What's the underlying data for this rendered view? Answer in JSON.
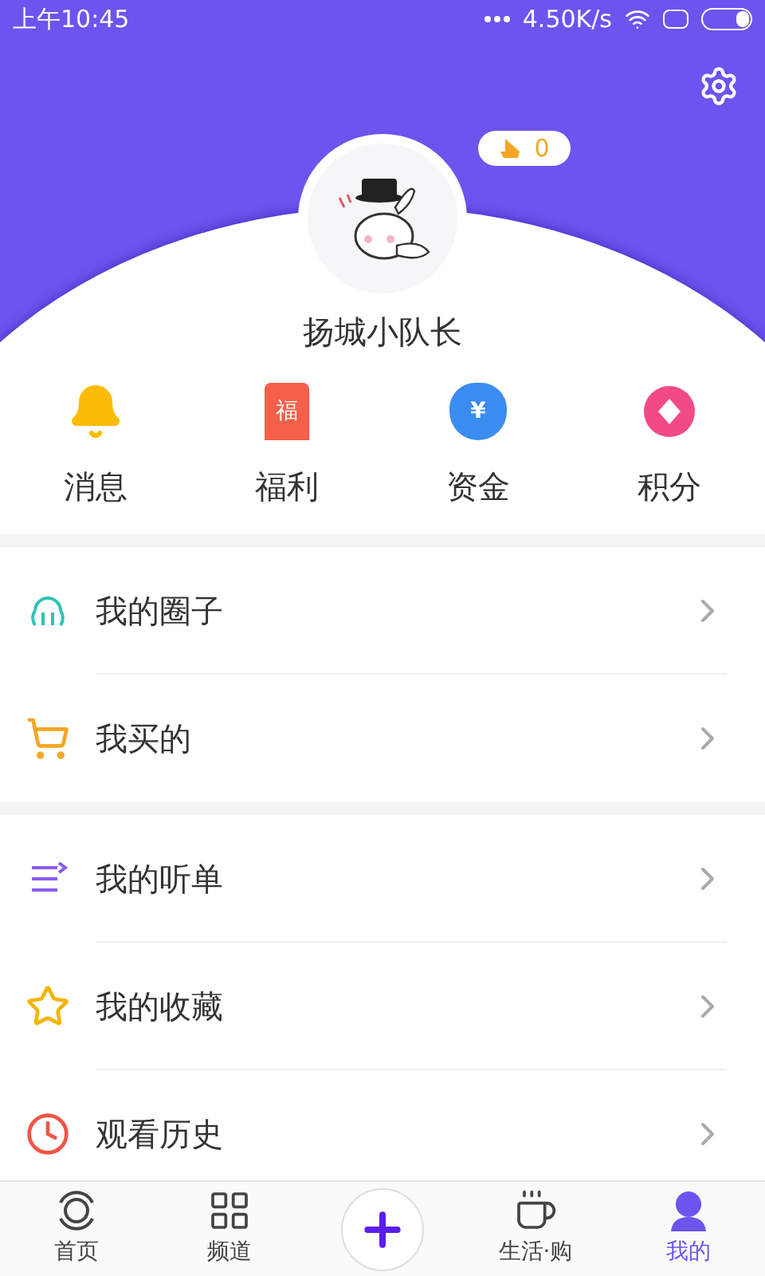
{
  "status_bar": {
    "time": "上午10:45",
    "speed": "4.50K/s"
  },
  "profile": {
    "name": "扬城小队长",
    "coins": "0"
  },
  "quick_actions": [
    {
      "label": "消息"
    },
    {
      "label": "福利",
      "icon_text": "福"
    },
    {
      "label": "资金",
      "icon_text": "¥"
    },
    {
      "label": "积分"
    }
  ],
  "menu_sections": [
    [
      {
        "label": "我的圈子"
      },
      {
        "label": "我买的"
      }
    ],
    [
      {
        "label": "我的听单"
      },
      {
        "label": "我的收藏"
      },
      {
        "label": "观看历史"
      }
    ]
  ],
  "bottom_nav": [
    {
      "kind": "tab",
      "label": "首页",
      "selected": false
    },
    {
      "kind": "tab",
      "label": "频道",
      "selected": false
    },
    {
      "kind": "add"
    },
    {
      "kind": "tab",
      "label": "生活·购",
      "selected": false
    },
    {
      "kind": "tab",
      "label": "我的",
      "selected": true
    }
  ]
}
